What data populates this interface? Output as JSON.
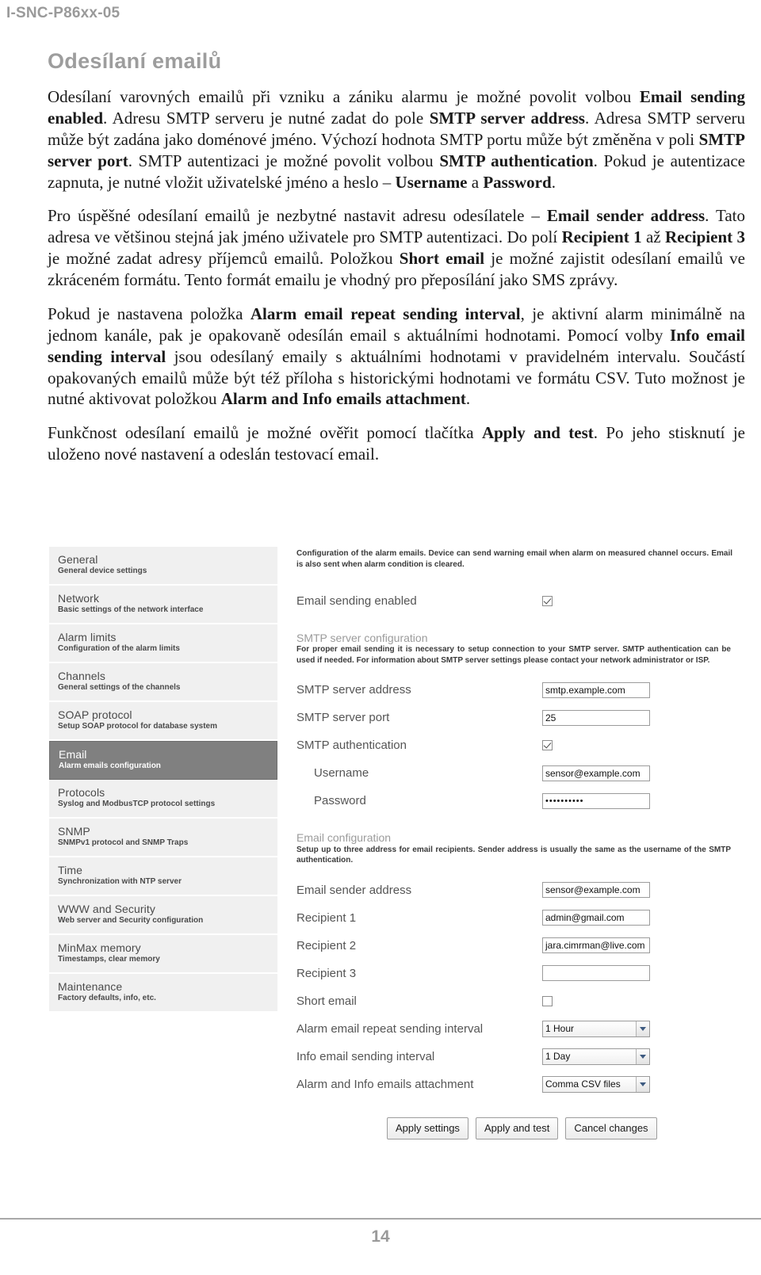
{
  "document": {
    "running_header": "I-SNC-P86xx-05",
    "page_number": "14",
    "section_title": "Odesílaní emailů",
    "paragraphs": [
      "Odesílaní varovných emailů při vzniku a zániku alarmu je možné povolit volbou <b>Email sending enabled</b>. Adresu SMTP serveru je nutné zadat do pole <b>SMTP server address</b>. Adresa SMTP serveru může být zadána jako doménové jméno. Výchozí hodnota SMTP portu může být změněna v poli <b>SMTP server port</b>. SMTP autentizaci je možné povolit volbou <b>SMTP authentication</b>. Pokud je autentizace zapnuta, je nutné vložit uživatelské jméno a heslo – <b>Username</b> a <b>Password</b>.",
      "Pro úspěšné odesílaní emailů je nezbytné nastavit adresu odesílatele – <b>Email sender address</b>. Tato adresa ve většinou stejná jak jméno uživatele pro SMTP autentizaci. Do polí <b>Recipient 1</b> až <b>Recipient 3</b> je možné zadat adresy příjemců emailů. Položkou <b>Short email</b> je možné zajistit odesílaní emailů ve zkráceném formátu. Tento formát emailu je vhodný pro přeposílání jako SMS zprávy.",
      "Pokud je nastavena položka <b>Alarm email repeat sending interval</b>, je aktivní alarm minimálně na jednom kanále, pak je opakovaně odesílán email s aktuálními hodnotami. Pomocí volby <b>Info email sending interval</b> jsou odesílaný emaily s aktuálními hodnotami v pravidelném intervalu. Součástí opakovaných emailů může být též příloha s historickými hodnotami ve formátu CSV. Tuto možnost je nutné aktivovat položkou <b>Alarm and Info emails attachment</b>.",
      "Funkčnost odesílaní emailů je možné ověřit pomocí tlačítka <b>Apply and test</b>. Po jeho stisknutí je uloženo nové nastavení a odeslán testovací email."
    ]
  },
  "screenshot": {
    "sidebar": {
      "items": [
        {
          "title": "General",
          "subtitle": "General device settings",
          "active": false
        },
        {
          "title": "Network",
          "subtitle": "Basic settings of the network interface",
          "active": false
        },
        {
          "title": "Alarm limits",
          "subtitle": "Configuration of the alarm limits",
          "active": false
        },
        {
          "title": "Channels",
          "subtitle": "General settings of the channels",
          "active": false
        },
        {
          "title": "SOAP protocol",
          "subtitle": "Setup SOAP protocol for database system",
          "active": false
        },
        {
          "title": "Email",
          "subtitle": "Alarm emails configuration",
          "active": true
        },
        {
          "title": "Protocols",
          "subtitle": "Syslog and ModbusTCP protocol settings",
          "active": false
        },
        {
          "title": "SNMP",
          "subtitle": "SNMPv1 protocol and SNMP Traps",
          "active": false
        },
        {
          "title": "Time",
          "subtitle": "Synchronization with NTP server",
          "active": false
        },
        {
          "title": "WWW and Security",
          "subtitle": "Web server and Security configuration",
          "active": false
        },
        {
          "title": "MinMax memory",
          "subtitle": "Timestamps, clear memory",
          "active": false
        },
        {
          "title": "Maintenance",
          "subtitle": "Factory defaults, info, etc.",
          "active": false
        }
      ]
    },
    "panel": {
      "intro_note": "Configuration of the alarm emails. Device can send warning email when alarm on measured channel occurs. Email is also sent when alarm condition is cleared.",
      "email_sending_enabled": {
        "label": "Email sending enabled",
        "checked": true
      },
      "smtp_group": {
        "heading": "SMTP server configuration",
        "description": "For proper email sending it is necessary to setup connection to your SMTP server. SMTP authentication can be used if needed. For information about SMTP server settings please contact your network administrator or ISP.",
        "fields": {
          "server_address": {
            "label": "SMTP server address",
            "value": "smtp.example.com"
          },
          "server_port": {
            "label": "SMTP server port",
            "value": "25"
          },
          "authentication": {
            "label": "SMTP authentication",
            "checked": true
          },
          "username": {
            "label": "Username",
            "value": "sensor@example.com"
          },
          "password": {
            "label": "Password",
            "value": "••••••••••"
          }
        }
      },
      "email_group": {
        "heading": "Email configuration",
        "description": "Setup up to three address for email recipients. Sender address is usually the same as the username of the SMTP authentication.",
        "fields": {
          "sender_address": {
            "label": "Email sender address",
            "value": "sensor@example.com"
          },
          "recipient_1": {
            "label": "Recipient 1",
            "value": "admin@gmail.com"
          },
          "recipient_2": {
            "label": "Recipient 2",
            "value": "jara.cimrman@live.com"
          },
          "recipient_3": {
            "label": "Recipient 3",
            "value": ""
          },
          "short_email": {
            "label": "Short email",
            "checked": false
          },
          "alarm_repeat_interval": {
            "label": "Alarm email repeat sending interval",
            "value": "1 Hour"
          },
          "info_interval": {
            "label": "Info email sending interval",
            "value": "1 Day"
          },
          "attachment": {
            "label": "Alarm and Info emails attachment",
            "value": "Comma CSV files"
          }
        }
      },
      "buttons": {
        "apply_settings": "Apply settings",
        "apply_and_test": "Apply and test",
        "cancel_changes": "Cancel changes"
      }
    }
  },
  "colors": {
    "header_gray": "#9a9a9a",
    "active_item": "#808080",
    "item_bg": "#f0f0f0"
  }
}
